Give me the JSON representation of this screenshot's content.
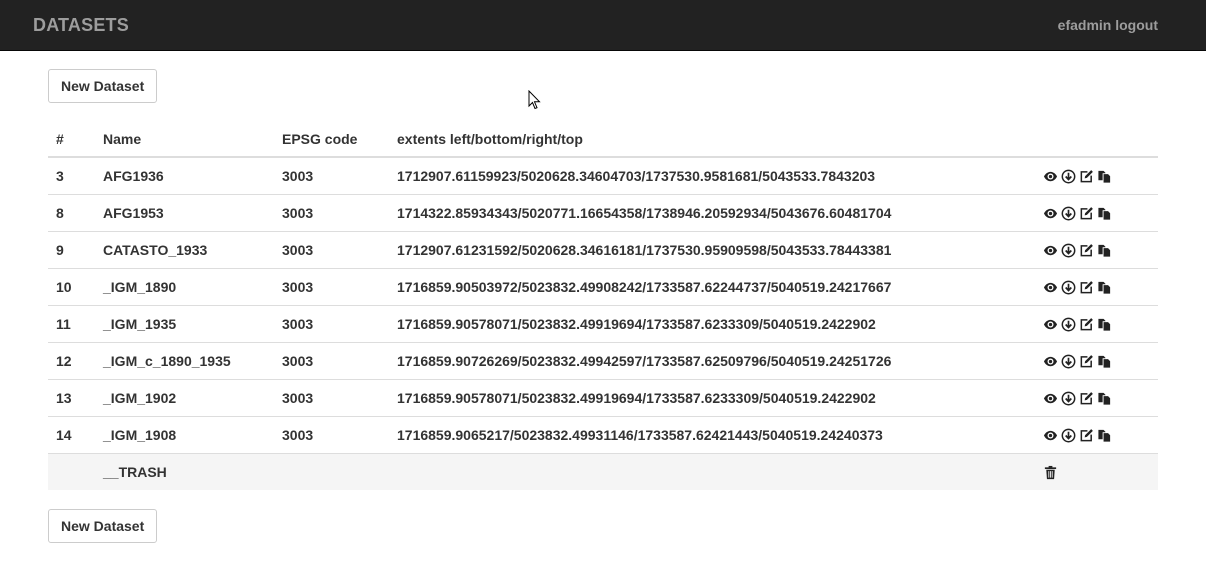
{
  "navbar": {
    "brand": "DATASETS",
    "user": "efadmin",
    "logout": "logout"
  },
  "buttons": {
    "new_dataset": "New Dataset"
  },
  "table": {
    "headers": {
      "id": "#",
      "name": "Name",
      "epsg": "EPSG code",
      "extents": "extents left/bottom/right/top"
    },
    "rows": [
      {
        "id": "3",
        "name": "AFG1936",
        "epsg": "3003",
        "extents": "1712907.61159923/5020628.34604703/1737530.9581681/5043533.7843203"
      },
      {
        "id": "8",
        "name": "AFG1953",
        "epsg": "3003",
        "extents": "1714322.85934343/5020771.16654358/1738946.20592934/5043676.60481704"
      },
      {
        "id": "9",
        "name": "CATASTO_1933",
        "epsg": "3003",
        "extents": "1712907.61231592/5020628.34616181/1737530.95909598/5043533.78443381"
      },
      {
        "id": "10",
        "name": "_IGM_1890",
        "epsg": "3003",
        "extents": "1716859.90503972/5023832.49908242/1733587.62244737/5040519.24217667"
      },
      {
        "id": "11",
        "name": "_IGM_1935",
        "epsg": "3003",
        "extents": "1716859.90578071/5023832.49919694/1733587.6233309/5040519.2422902"
      },
      {
        "id": "12",
        "name": "_IGM_c_1890_1935",
        "epsg": "3003",
        "extents": "1716859.90726269/5023832.49942597/1733587.62509796/5040519.24251726"
      },
      {
        "id": "13",
        "name": "_IGM_1902",
        "epsg": "3003",
        "extents": "1716859.90578071/5023832.49919694/1733587.6233309/5040519.2422902"
      },
      {
        "id": "14",
        "name": "_IGM_1908",
        "epsg": "3003",
        "extents": "1716859.9065217/5023832.49931146/1733587.62421443/5040519.24240373"
      }
    ],
    "row_action_icons": [
      "eye-icon",
      "download-icon",
      "edit-icon",
      "copy-icon"
    ],
    "trash_row": {
      "name": "__TRASH",
      "icon": "trash-icon"
    }
  }
}
